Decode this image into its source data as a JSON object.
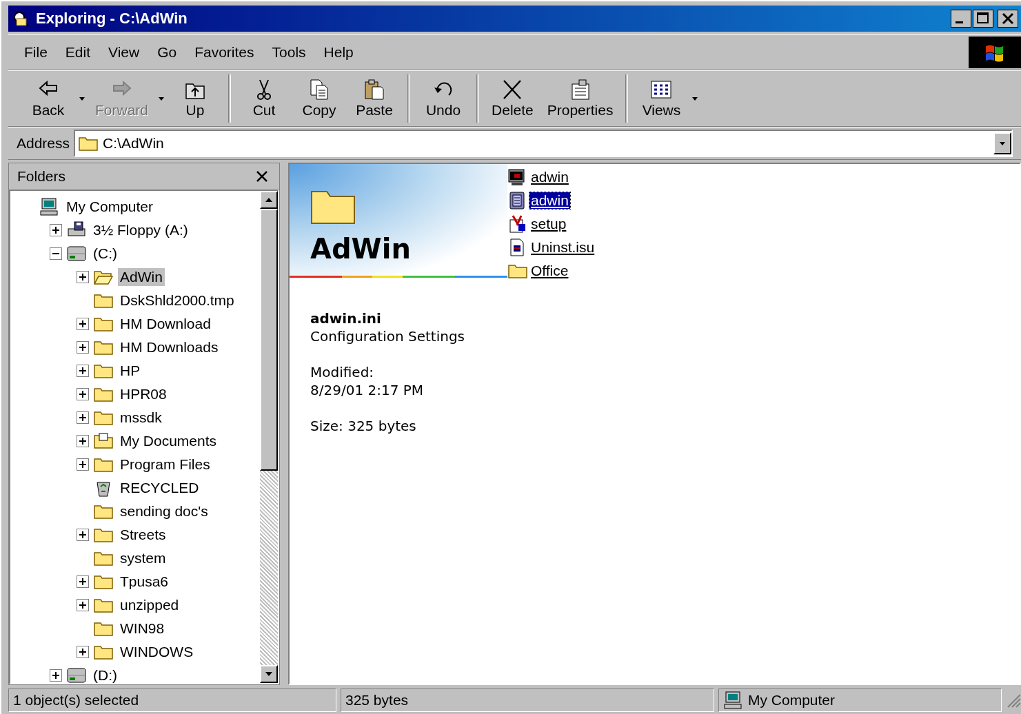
{
  "window": {
    "title": "Exploring - C:\\AdWin"
  },
  "menu": [
    {
      "label": "File"
    },
    {
      "label": "Edit"
    },
    {
      "label": "View"
    },
    {
      "label": "Go"
    },
    {
      "label": "Favorites"
    },
    {
      "label": "Tools"
    },
    {
      "label": "Help"
    }
  ],
  "toolbar": [
    {
      "kind": "back",
      "label": "Back",
      "disabled": false,
      "dropdown": true
    },
    {
      "kind": "forward",
      "label": "Forward",
      "disabled": true,
      "dropdown": true
    },
    {
      "kind": "up",
      "label": "Up",
      "disabled": false,
      "dropdown": false
    },
    {
      "kind": "separator"
    },
    {
      "kind": "cut",
      "label": "Cut",
      "disabled": false,
      "dropdown": false
    },
    {
      "kind": "copy",
      "label": "Copy",
      "disabled": false,
      "dropdown": false
    },
    {
      "kind": "paste",
      "label": "Paste",
      "disabled": false,
      "dropdown": false
    },
    {
      "kind": "separator"
    },
    {
      "kind": "undo",
      "label": "Undo",
      "disabled": false,
      "dropdown": false
    },
    {
      "kind": "separator"
    },
    {
      "kind": "delete",
      "label": "Delete",
      "disabled": false,
      "dropdown": false
    },
    {
      "kind": "properties",
      "label": "Properties",
      "disabled": false,
      "dropdown": false
    },
    {
      "kind": "separator"
    },
    {
      "kind": "views",
      "label": "Views",
      "disabled": false,
      "dropdown": true
    }
  ],
  "address": {
    "label": "Address",
    "value": "C:\\AdWin"
  },
  "folders": {
    "title": "Folders",
    "tree": [
      {
        "label": "My Computer",
        "kind": "computer",
        "expandable": false,
        "selected": false,
        "children": [
          {
            "label": "3½ Floppy (A:)",
            "kind": "floppy",
            "expandable": true,
            "expanded": false,
            "selected": false
          },
          {
            "label": "(C:)",
            "kind": "drive",
            "expandable": true,
            "expanded": true,
            "selected": false,
            "children": [
              {
                "label": "AdWin",
                "kind": "folder-open",
                "expandable": true,
                "expanded": false,
                "selected": true
              },
              {
                "label": "DskShld2000.tmp",
                "kind": "folder",
                "expandable": false,
                "selected": false
              },
              {
                "label": "HM Download",
                "kind": "folder",
                "expandable": true,
                "expanded": false,
                "selected": false
              },
              {
                "label": "HM Downloads",
                "kind": "folder",
                "expandable": true,
                "expanded": false,
                "selected": false
              },
              {
                "label": "HP",
                "kind": "folder",
                "expandable": true,
                "expanded": false,
                "selected": false
              },
              {
                "label": "HPR08",
                "kind": "folder",
                "expandable": true,
                "expanded": false,
                "selected": false
              },
              {
                "label": "mssdk",
                "kind": "folder",
                "expandable": true,
                "expanded": false,
                "selected": false
              },
              {
                "label": "My Documents",
                "kind": "documents",
                "expandable": true,
                "expanded": false,
                "selected": false
              },
              {
                "label": "Program Files",
                "kind": "folder",
                "expandable": true,
                "expanded": false,
                "selected": false
              },
              {
                "label": "RECYCLED",
                "kind": "recycle",
                "expandable": false,
                "selected": false
              },
              {
                "label": "sending doc's",
                "kind": "folder",
                "expandable": false,
                "selected": false
              },
              {
                "label": "Streets",
                "kind": "folder",
                "expandable": true,
                "expanded": false,
                "selected": false
              },
              {
                "label": "system",
                "kind": "folder",
                "expandable": false,
                "selected": false
              },
              {
                "label": "Tpusa6",
                "kind": "folder",
                "expandable": true,
                "expanded": false,
                "selected": false
              },
              {
                "label": "unzipped",
                "kind": "folder",
                "expandable": true,
                "expanded": false,
                "selected": false
              },
              {
                "label": "WIN98",
                "kind": "folder",
                "expandable": false,
                "selected": false
              },
              {
                "label": "WINDOWS",
                "kind": "folder",
                "expandable": true,
                "expanded": false,
                "selected": false
              }
            ]
          },
          {
            "label": "(D:)",
            "kind": "drive",
            "expandable": true,
            "expanded": false,
            "selected": false
          }
        ]
      }
    ]
  },
  "view": {
    "heading": "AdWin",
    "info": {
      "name": "adwin.ini",
      "type": "Configuration Settings",
      "modified_label": "Modified:",
      "modified": "8/29/01 2:17 PM",
      "size": "Size: 325 bytes"
    },
    "files": [
      {
        "label": "adwin",
        "kind": "app",
        "selected": false
      },
      {
        "label": "adwin",
        "kind": "settings",
        "selected": true
      },
      {
        "label": "setup",
        "kind": "setup",
        "selected": false
      },
      {
        "label": "Uninst.isu",
        "kind": "document",
        "selected": false
      },
      {
        "label": "Office",
        "kind": "folder",
        "selected": false
      }
    ]
  },
  "status_bar": {
    "selection": "1 object(s) selected",
    "size": "325 bytes",
    "zone": "My Computer"
  }
}
